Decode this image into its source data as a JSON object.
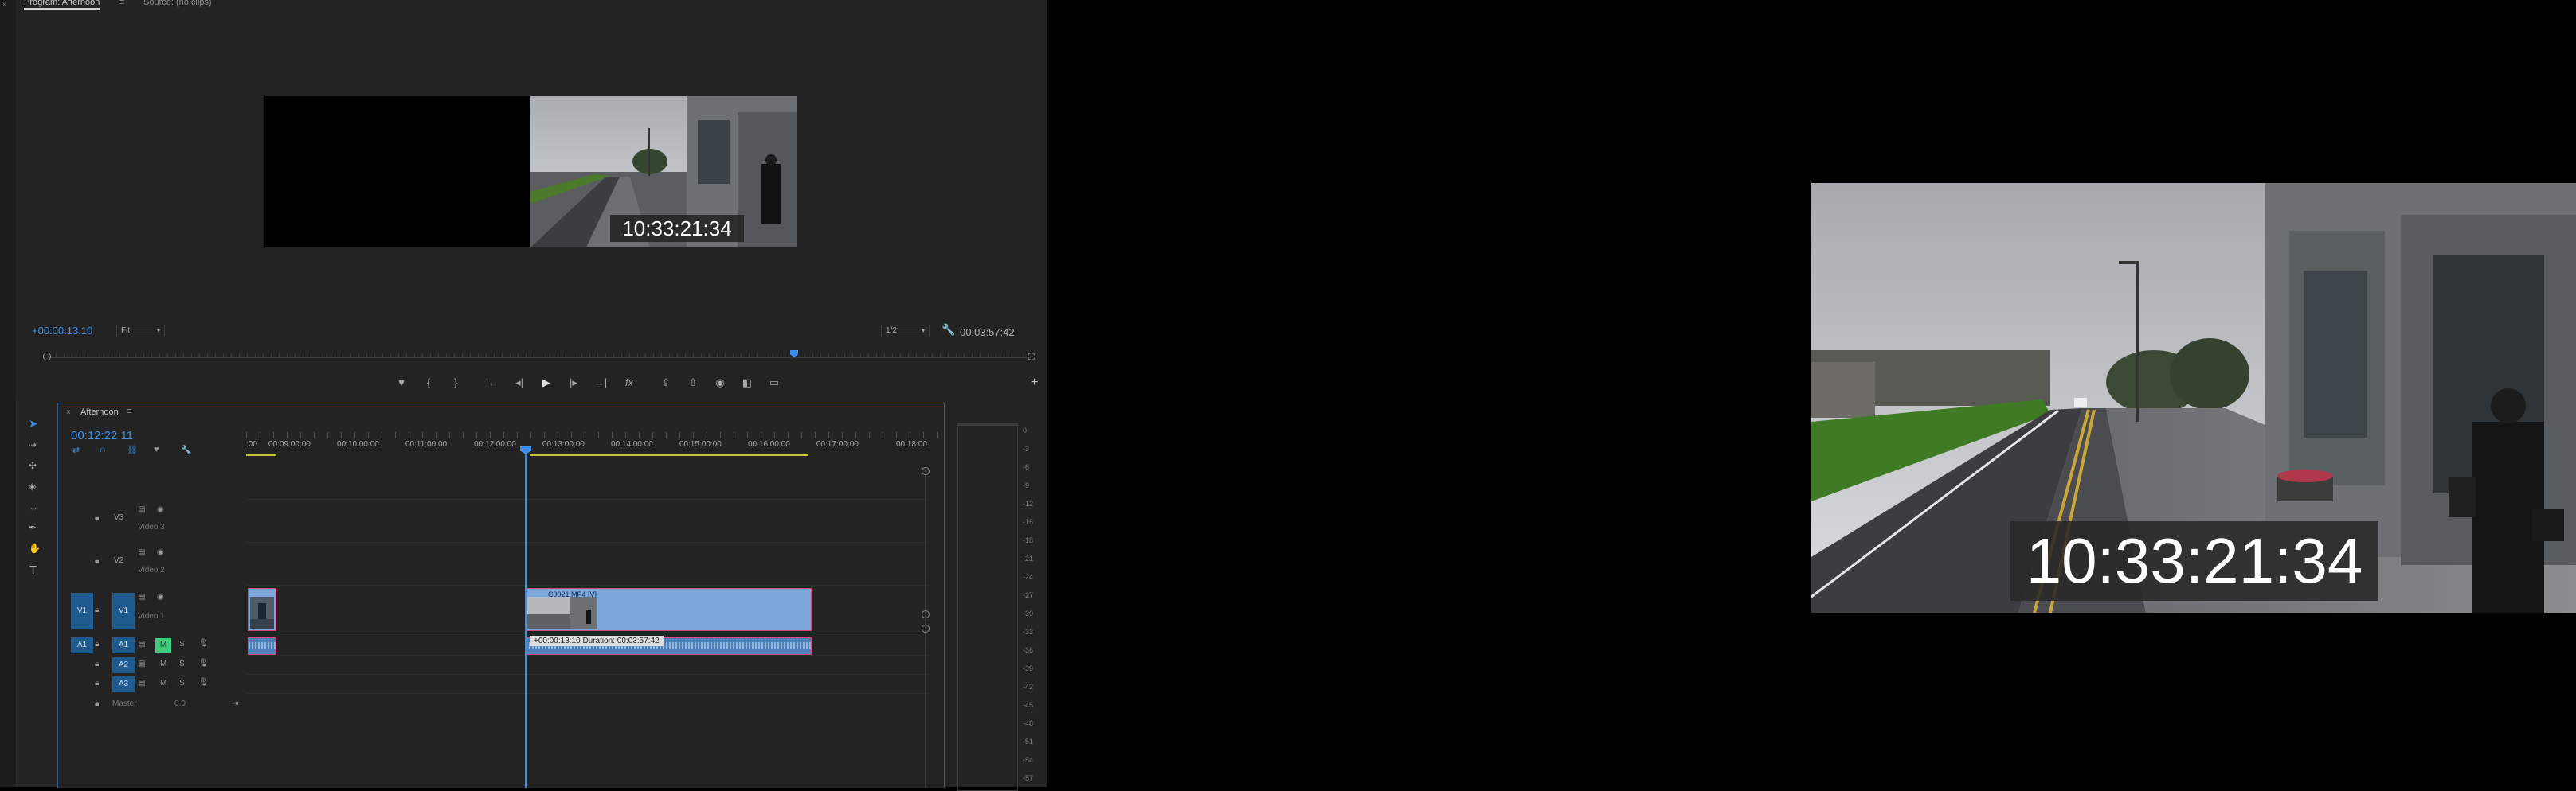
{
  "program_monitor": {
    "tab_program": "Program: Afternoon",
    "tab_source": "Source: (no clips)",
    "burned_timecode": "10:33:21:34",
    "current_timecode": "+00:00:13:10",
    "fit_label": "Fit",
    "resolution_label": "1/2",
    "duration_timecode": "00:03:57:42"
  },
  "transport": {
    "add_marker": "♥",
    "mark_in": "{",
    "mark_out": "}",
    "go_to_in": "|←",
    "step_back": "◂|",
    "play": "▶",
    "step_forward": "|▸",
    "go_to_out": "→|",
    "fx": "fx",
    "lift": "⇪",
    "extract": "⇫",
    "export_frame": "◉",
    "compare": "◧",
    "safe_margins": "▭",
    "add_button": "+"
  },
  "timeline": {
    "close_x": "×",
    "sequence_name": "Afternoon",
    "menu_icon": "≡",
    "playhead_timecode": "00:12:22:11",
    "ruler_labels": [
      ":00",
      "00:09:00:00",
      "00:10:00:00",
      "00:11:00:00",
      "00:12:00:00",
      "00:13:00:00",
      "00:14:00:00",
      "00:15:00:00",
      "00:16:00:00",
      "00:17:00:00",
      "00:18:00"
    ],
    "tracks": {
      "v3": {
        "label": "V3",
        "name": "Video 3"
      },
      "v2": {
        "label": "V2",
        "name": "Video 2"
      },
      "v1": {
        "source": "V1",
        "label": "V1",
        "name": "Video 1"
      },
      "a1": {
        "source": "A1",
        "label": "A1",
        "m": "M",
        "s": "S"
      },
      "a2": {
        "label": "A2",
        "m": "M",
        "s": "S"
      },
      "a3": {
        "label": "A3",
        "m": "M",
        "s": "S"
      },
      "master": {
        "name": "Master",
        "value": "0.0"
      }
    },
    "clip_label": "C0021.MP4 [V]",
    "tooltip": "+00:00:13:10 Duration: 00:03:57:42"
  },
  "audio_meter": {
    "db_labels": [
      "0",
      "-3",
      "-6",
      "-9",
      "-12",
      "-15",
      "-18",
      "-21",
      "-24",
      "-27",
      "-30",
      "-33",
      "-36",
      "-39",
      "-42",
      "-45",
      "-48",
      "-51",
      "-54",
      "-57"
    ]
  },
  "colors": {
    "accent_blue": "#3d8ee8",
    "panel_bg": "#232323",
    "clip_video": "#7da7db",
    "clip_audio": "#4f7fb8",
    "work_area": "#c9c23a",
    "solo_green": "#3ecb7a"
  }
}
